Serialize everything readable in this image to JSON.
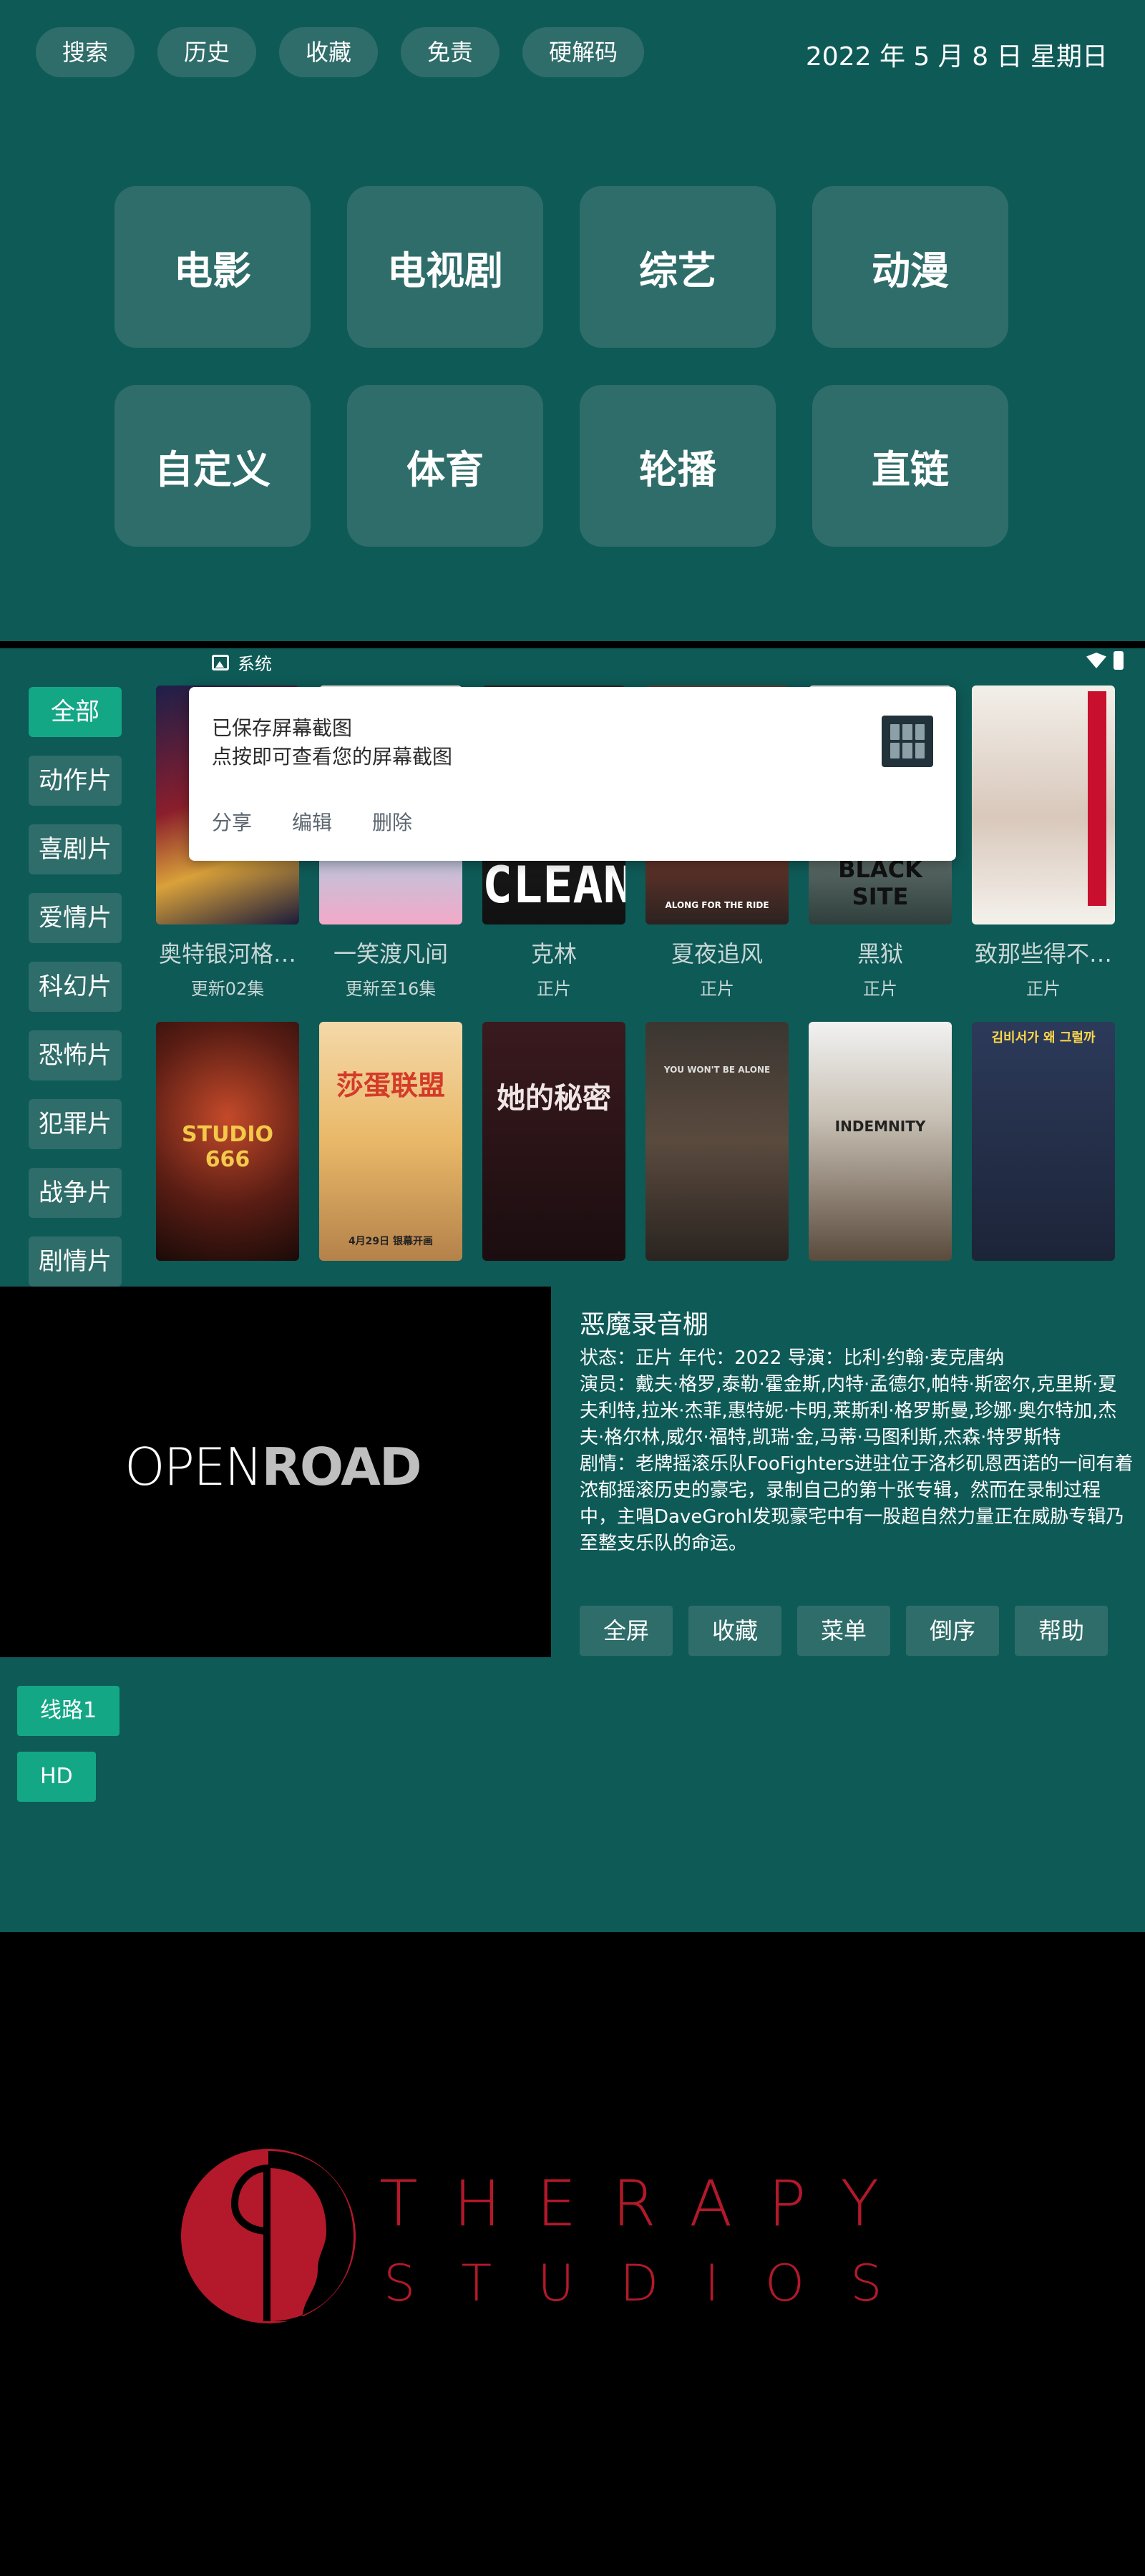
{
  "topbar": {
    "buttons": [
      "搜索",
      "历史",
      "收藏",
      "免责",
      "硬解码"
    ],
    "date": "2022 年 5 月 8 日 星期日"
  },
  "home_tiles": [
    "电影",
    "电视剧",
    "综艺",
    "动漫",
    "自定义",
    "体育",
    "轮播",
    "直链"
  ],
  "status_bar": {
    "label": "系统"
  },
  "categories": [
    "全部",
    "动作片",
    "喜剧片",
    "爱情片",
    "科幻片",
    "恐怖片",
    "犯罪片",
    "战争片",
    "剧情片"
  ],
  "movies": [
    {
      "title": "奥特银河格…",
      "sub": "更新02集"
    },
    {
      "title": "一笑渡凡间",
      "sub": "更新至16集"
    },
    {
      "title": "克林",
      "sub": "正片"
    },
    {
      "title": "夏夜追风",
      "sub": "正片"
    },
    {
      "title": "黑狱",
      "sub": "正片"
    },
    {
      "title": "致那些得不…",
      "sub": "正片"
    },
    {
      "title": "",
      "sub": ""
    },
    {
      "title": "",
      "sub": ""
    },
    {
      "title": "",
      "sub": ""
    },
    {
      "title": "",
      "sub": ""
    },
    {
      "title": "",
      "sub": ""
    },
    {
      "title": "",
      "sub": ""
    }
  ],
  "poster_texts": {
    "clean": "CLEAN",
    "black_site": "BLACK SITE",
    "ride_caption": "ALONG FOR THE RIDE",
    "studio": "STUDIO 666",
    "indemnity": "INDEMNITY",
    "wont_be_alone": "YOU WON'T BE ALONE",
    "date_caption": "4月29日 银幕开画",
    "poster2_title": "莎蛋联盟",
    "poster3_title": "她的秘密",
    "poster6_title": "김비서가 왜 그럴까"
  },
  "toast": {
    "title": "已保存屏幕截图",
    "subtitle": "点按即可查看您的屏幕截图",
    "actions": [
      "分享",
      "编辑",
      "删除"
    ]
  },
  "detail": {
    "title": "恶魔录音棚",
    "status_line": "状态：正片    年代：2022    导演：比利·约翰·麦克唐纳",
    "cast_line": "演员：戴夫·格罗,泰勒·霍金斯,内特·孟德尔,帕特·斯密尔,克里斯·夏夫利特,拉米·杰菲,惠特妮·卡明,莱斯利·格罗斯曼,珍娜·奥尔特加,杰夫·格尔林,威尔·福特,凯瑞·金,马蒂·马图利斯,杰森·特罗斯特",
    "plot_line": "剧情：老牌摇滚乐队FooFighters进驻位于洛杉矶恩西诺的一间有着浓郁摇滚历史的豪宅，录制自己的第十张专辑，然而在录制过程中，主唱DaveGrohl发现豪宅中有一股超自然力量正在威胁专辑乃至整支乐队的命运。",
    "buttons": [
      "全屏",
      "收藏",
      "菜单",
      "倒序",
      "帮助"
    ],
    "lines": [
      "线路1",
      "HD"
    ],
    "video_logo": {
      "part1": "OPEN",
      "part2": "ROAD"
    }
  },
  "splash": {
    "line1": "THERAPY",
    "line2": "STUDIOS",
    "brand_color": "#b3192a"
  },
  "colors": {
    "background": "#0e5a57",
    "tile": "#2f6d6a",
    "accent": "#14a786"
  }
}
